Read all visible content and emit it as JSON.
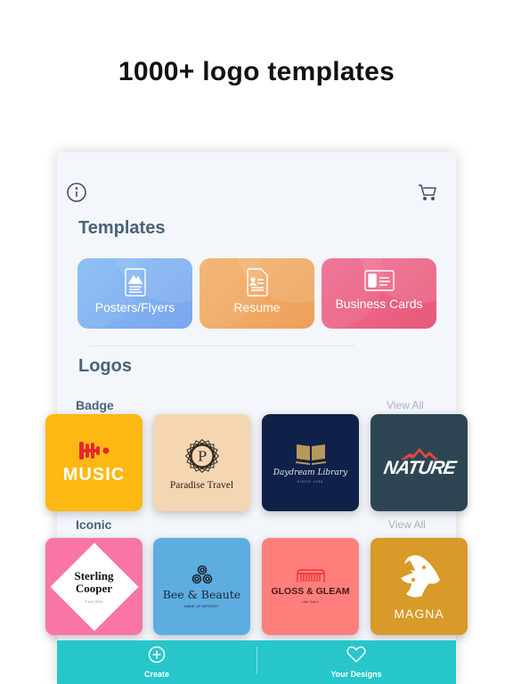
{
  "headline": "1000+ logo templates",
  "app": {
    "icons": {
      "info": "info-icon",
      "cart": "cart-icon"
    },
    "templates_title": "Templates",
    "templates": [
      {
        "label": "Posters/Flyers",
        "icon": "poster-icon",
        "color": "#7fb1f1"
      },
      {
        "label": "Resume",
        "icon": "resume-icon",
        "color": "#f0a962"
      },
      {
        "label": "Business Cards",
        "icon": "business-card-icon",
        "color": "#eb6384"
      }
    ],
    "logos_title": "Logos",
    "categories": [
      {
        "name": "Badge",
        "view_all": "View All",
        "items": [
          {
            "text": "MUSIC",
            "color": "#fdb813"
          },
          {
            "text": "Paradise Travel",
            "monogram": "P",
            "color": "#f5d6b2"
          },
          {
            "text": "Daydream Library",
            "subtext": "SINCE 1986",
            "color": "#0f2148"
          },
          {
            "text": "NATURE",
            "color": "#2d4553"
          }
        ]
      },
      {
        "name": "Iconic",
        "view_all": "View All",
        "items": [
          {
            "text": "Sterling Cooper",
            "subtext": "FASION",
            "color": "#f975a5"
          },
          {
            "text": "Bee & Beaute",
            "subtext": "MAKE UP ARTISTRY",
            "color": "#5dade0"
          },
          {
            "text": "GLOSS & GLEAM",
            "subtext": "Hair Salon",
            "color": "#ff7f7c"
          },
          {
            "text": "MAGNA",
            "color": "#d89a28"
          }
        ]
      }
    ],
    "bottom_nav": [
      {
        "label": "Create",
        "icon": "plus-circle-icon"
      },
      {
        "label": "Your Designs",
        "icon": "heart-icon"
      }
    ],
    "colors": {
      "accent": "#27c6cb",
      "heading": "#4a6278",
      "background": "#f3f6fb"
    }
  }
}
